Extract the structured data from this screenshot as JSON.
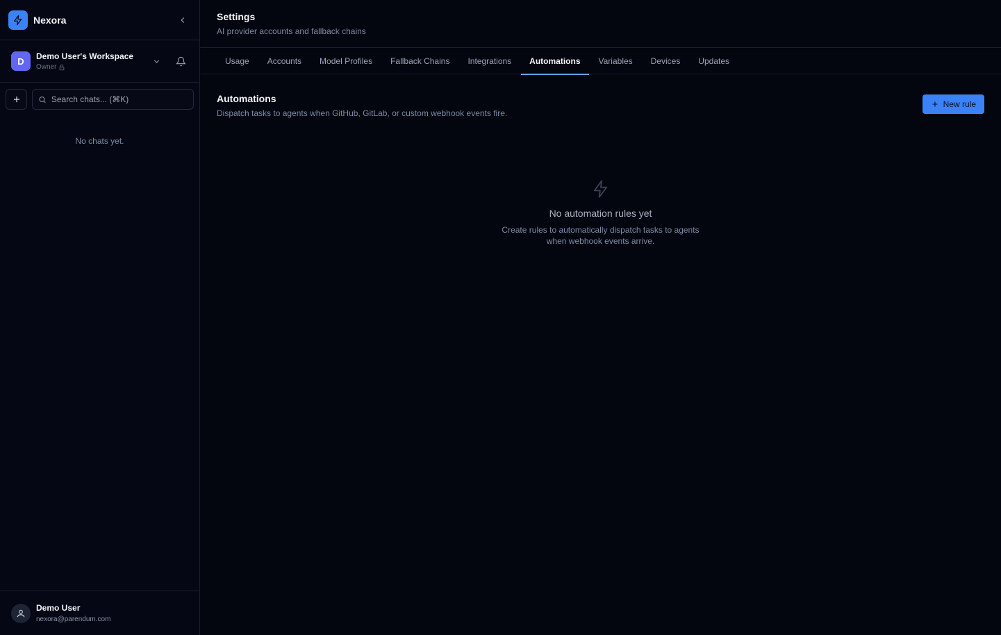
{
  "brand": {
    "name": "Nexora"
  },
  "workspace": {
    "initial": "D",
    "name": "Demo User's Workspace",
    "role": "Owner"
  },
  "search": {
    "placeholder": "Search chats... (⌘K)"
  },
  "chats": {
    "empty_text": "No chats yet."
  },
  "user": {
    "name": "Demo User",
    "email": "nexora@parendum.com"
  },
  "header": {
    "title": "Settings",
    "subtitle": "AI provider accounts and fallback chains"
  },
  "tabs": [
    {
      "label": "Usage"
    },
    {
      "label": "Accounts"
    },
    {
      "label": "Model Profiles"
    },
    {
      "label": "Fallback Chains"
    },
    {
      "label": "Integrations"
    },
    {
      "label": "Automations",
      "active": true
    },
    {
      "label": "Variables"
    },
    {
      "label": "Devices"
    },
    {
      "label": "Updates"
    }
  ],
  "automations": {
    "title": "Automations",
    "description": "Dispatch tasks to agents when GitHub, GitLab, or custom webhook events fire.",
    "new_rule_label": "New rule",
    "empty_title": "No automation rules yet",
    "empty_description": "Create rules to automatically dispatch tasks to agents when webhook events arrive."
  },
  "colors": {
    "accent": "#3b82f6",
    "background": "#04060f",
    "avatar": "#6366f1"
  },
  "icons": [
    "bolt-icon",
    "chevron-left-icon",
    "chevron-down-icon",
    "bell-icon",
    "lock-icon",
    "plus-icon",
    "search-icon",
    "user-icon"
  ]
}
